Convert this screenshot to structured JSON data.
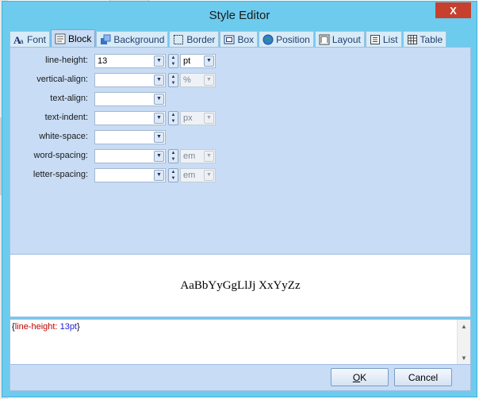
{
  "window": {
    "title": "Style Editor",
    "close_glyph": "X"
  },
  "tabs": [
    {
      "label": "Font",
      "icon": "font-icon"
    },
    {
      "label": "Block",
      "icon": "block-icon",
      "active": true
    },
    {
      "label": "Background",
      "icon": "background-icon"
    },
    {
      "label": "Border",
      "icon": "border-icon"
    },
    {
      "label": "Box",
      "icon": "box-icon"
    },
    {
      "label": "Position",
      "icon": "position-icon"
    },
    {
      "label": "Layout",
      "icon": "layout-icon"
    },
    {
      "label": "List",
      "icon": "list-icon"
    },
    {
      "label": "Table",
      "icon": "table-icon"
    }
  ],
  "fields": {
    "line_height": {
      "label": "line-height:",
      "value": "13",
      "unit": "pt"
    },
    "vertical_align": {
      "label": "vertical-align:",
      "value": "",
      "unit": "%"
    },
    "text_align": {
      "label": "text-align:",
      "value": ""
    },
    "text_indent": {
      "label": "text-indent:",
      "value": "",
      "unit": "px"
    },
    "white_space": {
      "label": "white-space:",
      "value": ""
    },
    "word_spacing": {
      "label": "word-spacing:",
      "value": "",
      "unit": "em"
    },
    "letter_spacing": {
      "label": "letter-spacing:",
      "value": "",
      "unit": "em"
    }
  },
  "preview": {
    "text": "AaBbYyGgLlJj XxYyZz"
  },
  "css_output": {
    "open": "{",
    "property": "line-height",
    "colon": ": ",
    "value": "13pt",
    "close": "}"
  },
  "buttons": {
    "ok_prefix": "",
    "ok_mnemonic": "O",
    "ok_rest": "K",
    "cancel": "Cancel"
  },
  "colors": {
    "titlebar": "#6dcbee",
    "panel": "#c8dcf5",
    "close": "#c7402d",
    "css_property": "#c00000",
    "css_value": "#1f1fd0"
  }
}
